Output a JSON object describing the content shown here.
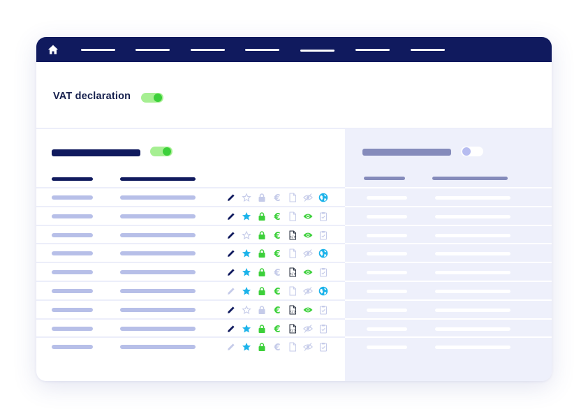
{
  "header": {
    "home_icon": "home-icon",
    "nav_items": [
      "",
      "",
      "",
      "",
      "",
      "",
      ""
    ]
  },
  "vat": {
    "label": "VAT declaration",
    "toggle_on": true
  },
  "left_panel": {
    "toggle_on": true
  },
  "right_panel": {
    "toggle_on": false
  },
  "rows": [
    {
      "edit": "on",
      "star": "off",
      "lock": "off",
      "euro": "off",
      "doc": "off",
      "eye": "off",
      "extra": "globe"
    },
    {
      "edit": "on",
      "star": "on",
      "lock": "on",
      "euro": "on",
      "doc": "off",
      "eye": "on",
      "extra": "clipboard-off"
    },
    {
      "edit": "on",
      "star": "off",
      "lock": "on",
      "euro": "on",
      "doc": "on",
      "eye": "on",
      "extra": "clipboard-off"
    },
    {
      "edit": "on",
      "star": "on",
      "lock": "on",
      "euro": "on",
      "doc": "off",
      "eye": "off",
      "extra": "globe"
    },
    {
      "edit": "on",
      "star": "on",
      "lock": "on",
      "euro": "off",
      "doc": "on",
      "eye": "on",
      "extra": "clipboard-off"
    },
    {
      "edit": "off",
      "star": "on",
      "lock": "on",
      "euro": "on",
      "doc": "off",
      "eye": "off",
      "extra": "globe"
    },
    {
      "edit": "on",
      "star": "off",
      "lock": "off",
      "euro": "on",
      "doc": "on",
      "eye": "on",
      "extra": "clipboard-off"
    },
    {
      "edit": "on",
      "star": "on",
      "lock": "on",
      "euro": "on",
      "doc": "on",
      "eye": "off",
      "extra": "clipboard-off"
    },
    {
      "edit": "off",
      "star": "on",
      "lock": "on",
      "euro": "off",
      "doc": "off",
      "eye": "off",
      "extra": "clipboard-off"
    }
  ],
  "colors": {
    "navy": "#101a5e",
    "green": "#3cd03a",
    "cyan": "#1cb3ea",
    "muted": "#c5cbe9",
    "placeholder": "#b7bfe8",
    "panel": "#eef0fb"
  }
}
